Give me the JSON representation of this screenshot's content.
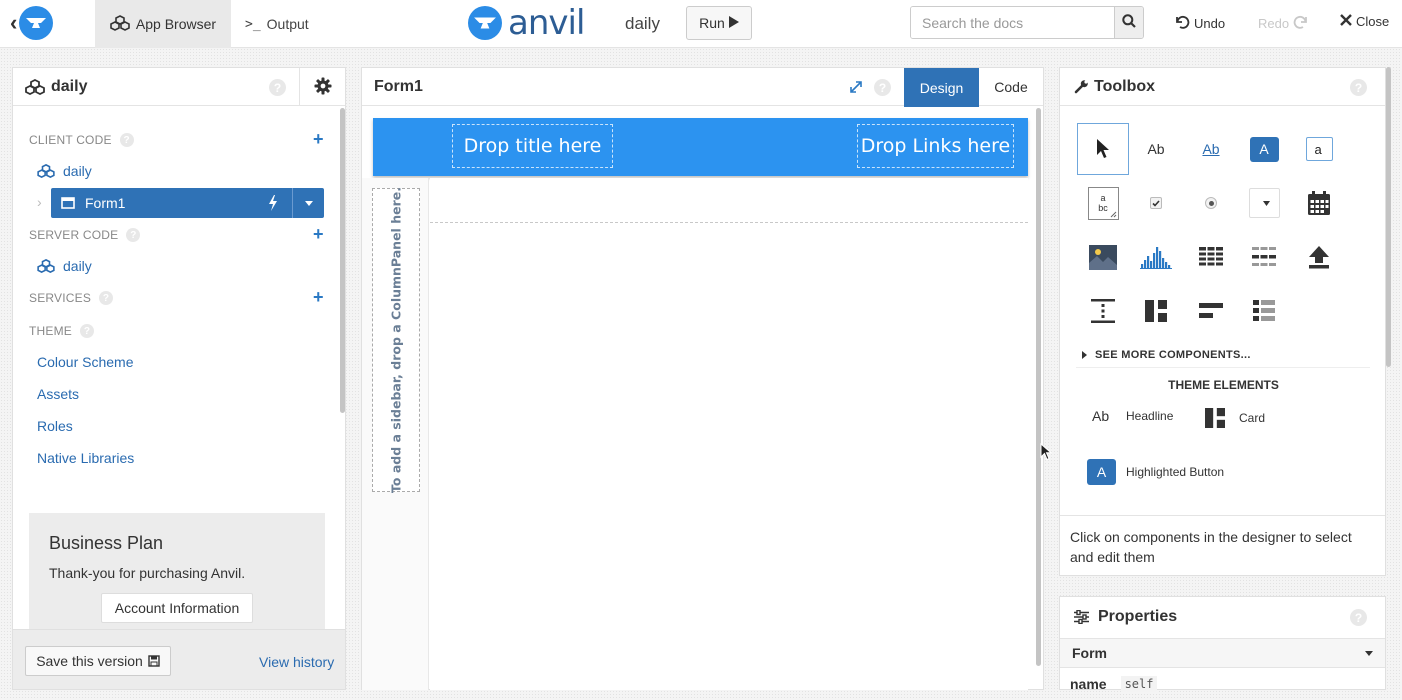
{
  "topbar": {
    "app_browser": "App Browser",
    "output": "Output",
    "output_prefix": ">_",
    "logo_text": "anvil",
    "app_name": "daily",
    "run": "Run",
    "search_placeholder": "Search the docs",
    "undo": "Undo",
    "redo": "Redo",
    "close": "Close"
  },
  "left": {
    "title": "daily",
    "client_code": "CLIENT CODE",
    "client_app": "daily",
    "form": "Form1",
    "server_code": "SERVER CODE",
    "server_app": "daily",
    "services": "SERVICES",
    "theme": "THEME",
    "theme_items": [
      "Colour Scheme",
      "Assets",
      "Roles",
      "Native Libraries"
    ],
    "plan_title": "Business Plan",
    "plan_text": "Thank-you for purchasing Anvil.",
    "account_button": "Account Information",
    "save_button": "Save this version",
    "view_history": "View history"
  },
  "center": {
    "title": "Form1",
    "tab_design": "Design",
    "tab_code": "Code",
    "drop_title": "Drop title here",
    "drop_links": "Drop Links here",
    "sidebar_hint": "To add a sidebar, drop a ColumnPanel here."
  },
  "toolbox": {
    "title": "Toolbox",
    "tools": {
      "label": "Ab",
      "link": "Ab",
      "button": "A",
      "textbox": "a",
      "textarea_line1": "a",
      "textarea_line2": "bc"
    },
    "see_more": "SEE MORE COMPONENTS...",
    "theme_elements": "THEME ELEMENTS",
    "theme_el_headline_icon": "Ab",
    "theme_el_headline": "Headline",
    "theme_el_card": "Card",
    "theme_el_button_icon": "A",
    "theme_el_button": "Highlighted Button",
    "hint": "Click on components in the designer to select and edit them"
  },
  "properties": {
    "title": "Properties",
    "section": "Form",
    "name_label": "name",
    "name_value": "self"
  },
  "colors": {
    "accent": "#2f72b6",
    "navbar": "#2c93f0",
    "link": "#2a6bb0"
  }
}
